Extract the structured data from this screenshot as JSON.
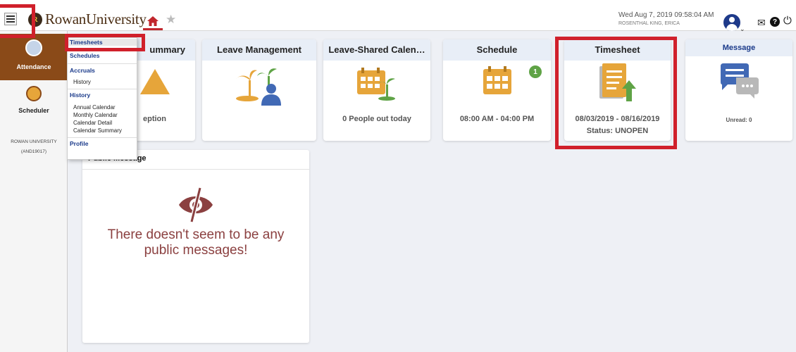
{
  "header": {
    "logo_initial": "R",
    "logo_text": "RowanUniversity",
    "datetime": "Wed Aug 7, 2019 09:58:04 AM",
    "username": "ROSENTHAL KING, ERICA"
  },
  "sidebar": {
    "items": [
      {
        "label": "Attendance",
        "icon": "person-icon"
      },
      {
        "label": "Scheduler",
        "icon": "calendar-icon"
      }
    ],
    "org_name": "ROWAN UNIVERSITY",
    "org_code": "(AND19017)"
  },
  "menu": {
    "timesheets": "Timesheets",
    "schedules": "Schedules",
    "accruals": "Accruals",
    "accruals_history": "History",
    "history": "History",
    "annual_calendar": "Annual Calendar",
    "monthly_calendar": "Monthly Calendar",
    "calendar_detail": "Calendar Detail",
    "calendar_summary": "Calendar Summary",
    "profile": "Profile"
  },
  "tiles": {
    "summary": {
      "title": "ummary",
      "value": "eption"
    },
    "leave_mgmt": {
      "title": "Leave Management"
    },
    "leave_shared": {
      "title": "Leave-Shared Calen…",
      "value": "0 People out today"
    },
    "schedule": {
      "title": "Schedule",
      "badge": "1",
      "value": "08:00 AM - 04:00 PM"
    },
    "timesheet": {
      "title": "Timesheet",
      "range": "08/03/2019 - 08/16/2019",
      "status": "Status: UNOPEN"
    },
    "message": {
      "title": "Message",
      "value": "Unread:  0"
    }
  },
  "public_message": {
    "title": "Public Message",
    "text_line1": "There doesn't seem to be any",
    "text_line2": "public messages!"
  },
  "colors": {
    "brand_brown": "#8a4a18",
    "highlight_red": "#d0202b",
    "tile_header": "#e8eef7",
    "accent_gold": "#e6a53a",
    "message_text": "#8b4040"
  }
}
